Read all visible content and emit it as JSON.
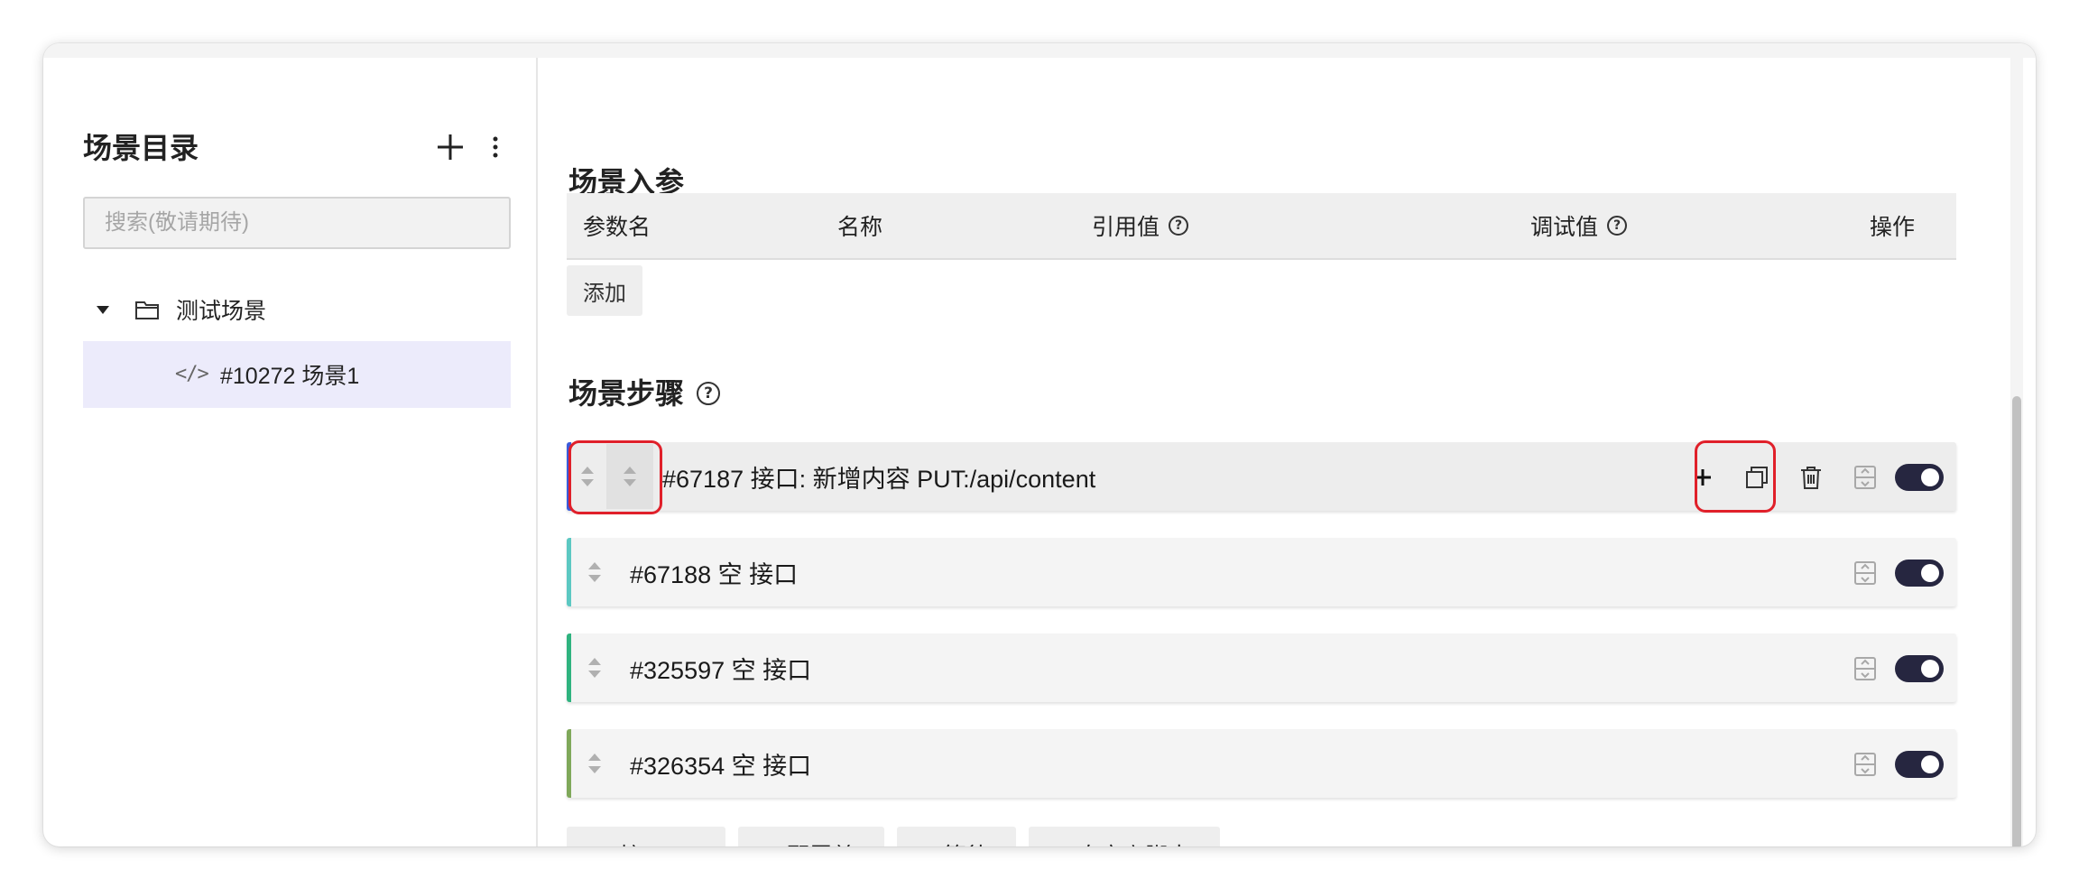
{
  "sidebar": {
    "title": "场景目录",
    "search_placeholder": "搜索(敬请期待)",
    "folder": {
      "label": "测试场景"
    },
    "item": {
      "label": "#10272 场景1"
    }
  },
  "params": {
    "title": "场景入参",
    "columns": [
      "参数名",
      "名称",
      "引用值",
      "调试值",
      "操作"
    ],
    "add_label": "添加"
  },
  "steps": {
    "title": "场景步骤",
    "items": [
      {
        "label": "#67187 接口: 新增内容 PUT:/api/content",
        "accent": "#3b5bdb",
        "enabled": true
      },
      {
        "label": "#67188 空 接口",
        "accent": "#5cc8c2",
        "enabled": true
      },
      {
        "label": "#325597 空 接口",
        "accent": "#2fb37f",
        "enabled": true
      },
      {
        "label": "#326354 空 接口",
        "accent": "#7fa85a",
        "enabled": true
      }
    ],
    "buttons": {
      "api": "+ 接口",
      "config": "+ 配置单",
      "wait": "+ 等待",
      "script": "+ 自定义脚本"
    }
  },
  "colors": {
    "selected_bg": "#ecebfb",
    "toggle_on": "#262640",
    "highlight_box": "#e0202a"
  }
}
